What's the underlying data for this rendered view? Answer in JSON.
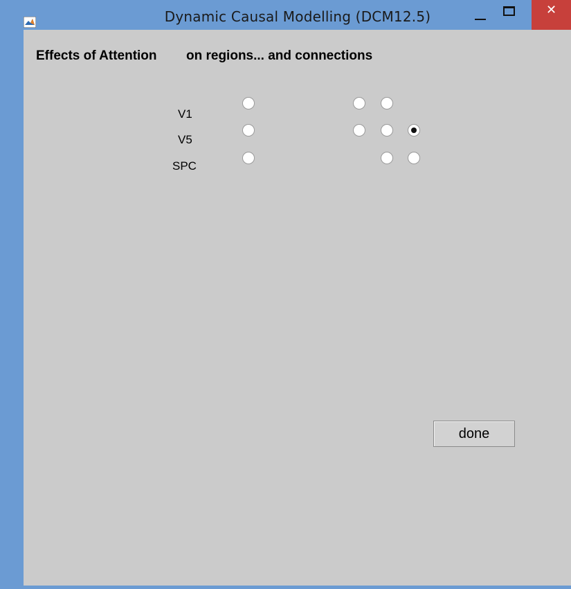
{
  "window": {
    "title": "Dynamic Causal Modelling (DCM12.5)",
    "close_glyph": "✕",
    "icons": [
      "matlab-icon",
      "minimize-icon",
      "maximize-icon",
      "close-icon"
    ]
  },
  "heading": {
    "effects_label": "Effects of Attention",
    "target_label": "on regions... and connections"
  },
  "regions": [
    {
      "label": "V1",
      "region_selected": false
    },
    {
      "label": "V5",
      "region_selected": false
    },
    {
      "label": "SPC",
      "region_selected": false
    }
  ],
  "connections": [
    {
      "name": "V1 to V1",
      "selected": false
    },
    {
      "name": "V1 to V5",
      "selected": false
    },
    {
      "name": "V5 to V1",
      "selected": false
    },
    {
      "name": "V5 to V5",
      "selected": false
    },
    {
      "name": "V5 to SPC",
      "selected": true
    },
    {
      "name": "SPC to V5",
      "selected": false
    },
    {
      "name": "SPC to SPC",
      "selected": false
    }
  ],
  "done_button": {
    "label": "done"
  },
  "colors": {
    "titlebar": "#6b9bd3",
    "panel": "#cbcbcb",
    "close_button": "#c7403b"
  }
}
